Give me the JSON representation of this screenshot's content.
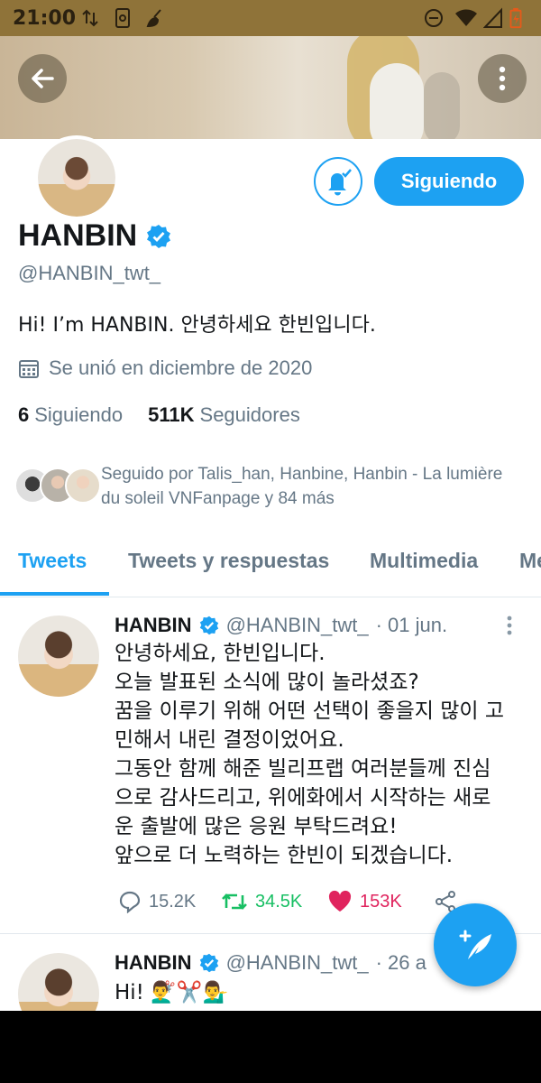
{
  "status_bar": {
    "time": "21:00"
  },
  "profile": {
    "name": "HANBIN",
    "handle": "@HANBIN_twt_",
    "bio": "Hi! I’m HANBIN. 안녕하세요 한빈입니다.",
    "joined": "Se unió en diciembre de 2020",
    "following_count": "6",
    "following_label": "Siguiendo",
    "followers_count": "511K",
    "followers_label": "Seguidores",
    "followed_by": "Seguido por Talis_han, Hanbine, Hanbin - La lumière du soleil VNFanpage y 84 más",
    "follow_button": "Siguiendo"
  },
  "tabs": [
    {
      "label": "Tweets",
      "active": true
    },
    {
      "label": "Tweets y respuestas",
      "active": false
    },
    {
      "label": "Multimedia",
      "active": false
    },
    {
      "label": "Me",
      "active": false
    }
  ],
  "tweets": [
    {
      "name": "HANBIN",
      "handle": "@HANBIN_twt_",
      "date": "· 01 jun.",
      "lines": [
        "안녕하세요, 한빈입니다.",
        "오늘 발표된 소식에 많이 놀라셨죠?",
        "꿈을 이루기 위해 어떤 선택이 좋을지 많이 고",
        "민해서 내린 결정이었어요.",
        "그동안 함께 해준 빌리프랩 여러분들께 진심",
        "으로 감사드리고, 위에화에서 시작하는 새로",
        "운 출발에 많은 응원 부탁드려요!",
        "앞으로 더 노력하는 한빈이 되겠습니다."
      ],
      "replies": "15.2K",
      "retweets": "34.5K",
      "likes": "153K"
    },
    {
      "name": "HANBIN",
      "handle": "@HANBIN_twt_",
      "date": "· 26 a",
      "text": "Hi! 💇‍♂️✂️💁‍♂️"
    }
  ],
  "colors": {
    "accent": "#1da1f2",
    "retweet": "#17bf63",
    "like": "#e0245e",
    "muted": "#657786"
  }
}
